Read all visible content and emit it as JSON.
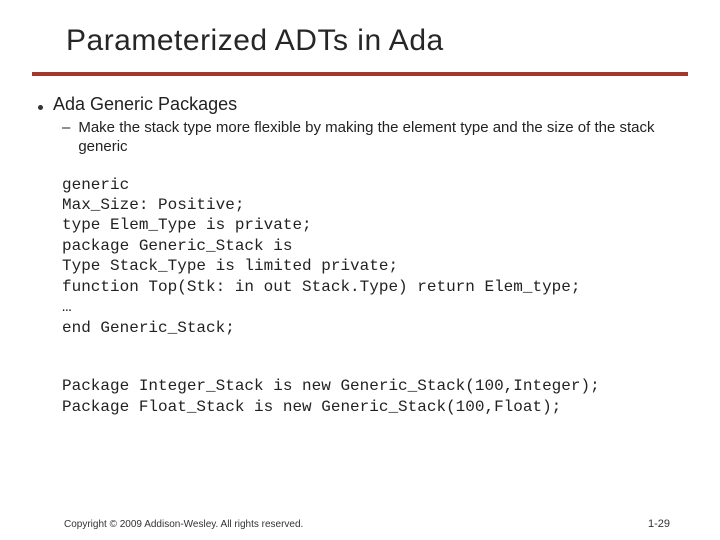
{
  "title": "Parameterized ADTs in Ada",
  "bullet1": "Ada Generic Packages",
  "bullet2": "Make the stack type more flexible by making the element type and the size of the stack generic",
  "code_main": "generic\nMax_Size: Positive;\ntype Elem_Type is private;\npackage Generic_Stack is\nType Stack_Type is limited private;\nfunction Top(Stk: in out Stack.Type) return Elem_type;\n…\nend Generic_Stack;",
  "code_inst": "Package Integer_Stack is new Generic_Stack(100,Integer);\nPackage Float_Stack is new Generic_Stack(100,Float);",
  "copyright": "Copyright © 2009 Addison-Wesley. All rights reserved.",
  "page_number": "1-29"
}
